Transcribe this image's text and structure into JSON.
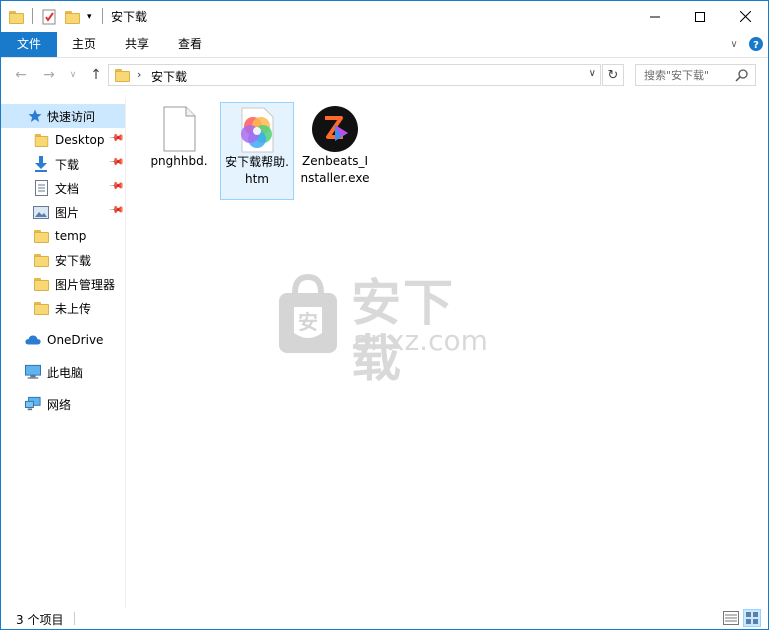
{
  "window": {
    "title": "安下载"
  },
  "ribbon": {
    "tabs": [
      "文件",
      "主页",
      "共享",
      "查看"
    ]
  },
  "address": {
    "path": "安下载",
    "search_placeholder": "搜索\"安下载\""
  },
  "sidebar": {
    "quick_access": "快速访问",
    "items": [
      {
        "label": "Desktop",
        "icon": "desktop-folder-icon",
        "pinned": true
      },
      {
        "label": "下载",
        "icon": "download-arrow-icon",
        "pinned": true
      },
      {
        "label": "文档",
        "icon": "document-icon",
        "pinned": true
      },
      {
        "label": "图片",
        "icon": "picture-icon",
        "pinned": true
      },
      {
        "label": "temp",
        "icon": "folder-icon",
        "pinned": false
      },
      {
        "label": "安下载",
        "icon": "folder-icon",
        "pinned": false
      },
      {
        "label": "图片管理器",
        "icon": "folder-icon",
        "pinned": false
      },
      {
        "label": "未上传",
        "icon": "folder-icon",
        "pinned": false
      }
    ],
    "onedrive": "OneDrive",
    "this_pc": "此电脑",
    "network": "网络"
  },
  "files": [
    {
      "name": "pnghhbd.",
      "icon": "blank-file-icon",
      "selected": false
    },
    {
      "name": "安下载帮助.htm",
      "icon": "colorful-circle-icon",
      "selected": true
    },
    {
      "name": "Zenbeats_Installer.exe",
      "icon": "zenbeats-app-icon",
      "selected": false
    }
  ],
  "watermark": {
    "cn": "安下载",
    "en": "anxz.com"
  },
  "status": {
    "count": "3 个项目"
  },
  "colors": {
    "accent": "#1979ca",
    "selection": "#cce8ff",
    "folder": "#f8d775"
  }
}
